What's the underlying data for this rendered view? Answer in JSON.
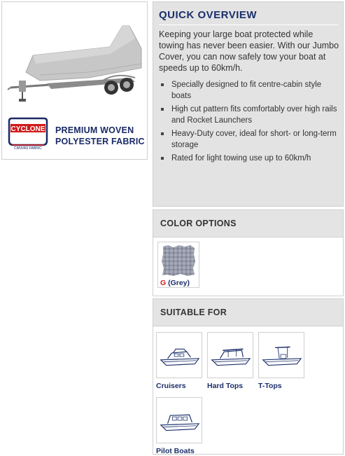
{
  "product": {
    "brand_logo_text": "CYCLONE",
    "brand_logo_sub": "CANVAS FABRIC",
    "fabric_line1": "PREMIUM WOVEN",
    "fabric_line2": "POLYESTER FABRIC"
  },
  "overview": {
    "title": "QUICK OVERVIEW",
    "intro": "Keeping your large boat protected while towing has never been easier. With our Jumbo Cover, you can now safely tow your boat at speeds up to 60km/h.",
    "features": [
      "Specially designed to fit centre-cabin style boats",
      "High cut pattern fits comfortably over high rails and Rocket Launchers",
      "Heavy-Duty cover, ideal for short- or long-term storage",
      "Rated for light towing use up to 60km/h"
    ]
  },
  "color_options": {
    "title": "COLOR OPTIONS",
    "options": [
      {
        "code": "G",
        "name": "(Grey)",
        "color": "#8e93a3"
      }
    ]
  },
  "suitable_for": {
    "title": "SUITABLE FOR",
    "boats": [
      {
        "label": "Cruisers",
        "icon": "cruiser-boat-icon"
      },
      {
        "label": "Hard Tops",
        "icon": "hard-top-boat-icon"
      },
      {
        "label": "T-Tops",
        "icon": "t-top-boat-icon"
      },
      {
        "label": "Pilot Boats",
        "icon": "pilot-boat-icon"
      }
    ]
  },
  "colors": {
    "heading_blue": "#1b2f6b",
    "accent_red": "#d11a1a",
    "panel_grey": "#e3e3e3"
  }
}
